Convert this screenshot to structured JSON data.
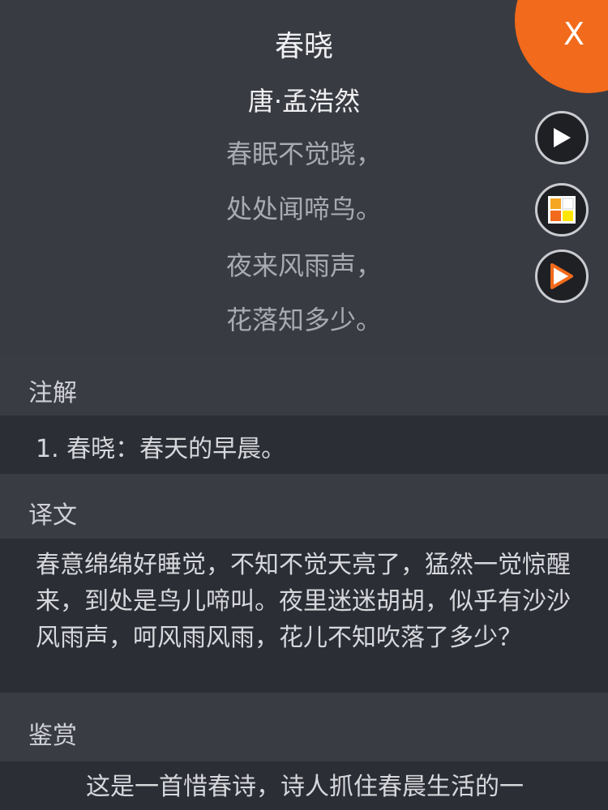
{
  "poem": {
    "title": "春晓",
    "author": "唐·孟浩然",
    "lines": [
      "春眠不觉晓，",
      "处处闻啼鸟。",
      "夜来风雨声，",
      "花落知多少。"
    ]
  },
  "close": {
    "label": "X"
  },
  "colors": {
    "accent": "#f26a1b",
    "background": "#393b42",
    "content_block": "#2c2e35"
  },
  "buttons": {
    "play": "play-icon",
    "grid": "grid-icon",
    "next": "next-play-icon"
  },
  "sections": {
    "notes": {
      "label": "注解",
      "items": [
        "1. 春晓：春天的早晨。"
      ]
    },
    "translation": {
      "label": "译文",
      "text": "春意绵绵好睡觉，不知不觉天亮了，猛然一觉惊醒来，到处是鸟儿啼叫。夜里迷迷胡胡，似乎有沙沙风雨声，呵风雨风雨，花儿不知吹落了多少？"
    },
    "appreciation": {
      "label": "鉴赏",
      "text": "这是一首惜春诗，诗人抓住春晨生活的一"
    }
  }
}
